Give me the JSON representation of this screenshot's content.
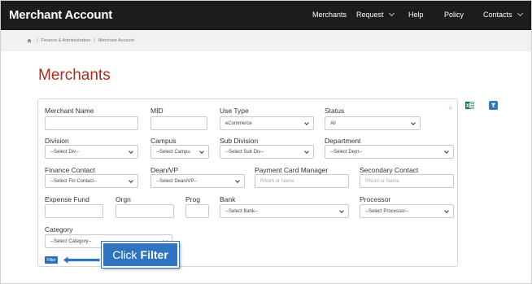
{
  "navbar": {
    "brand": "Merchant Account",
    "items": [
      {
        "label": "Merchants",
        "dropdown": false
      },
      {
        "label": "Request",
        "dropdown": true
      },
      {
        "label": "Help",
        "dropdown": false
      },
      {
        "label": "Policy",
        "dropdown": false
      },
      {
        "label": "Contacts",
        "dropdown": true
      }
    ]
  },
  "breadcrumb": {
    "sep1": "/",
    "item1": "Finance & Administration",
    "sep2": "/",
    "item2": "Merchant Account"
  },
  "page": {
    "title": "Merchants"
  },
  "form": {
    "merchant_name": {
      "label": "Merchant Name",
      "value": ""
    },
    "mid": {
      "label": "MID",
      "value": ""
    },
    "use_type": {
      "label": "Use Type",
      "value": "eCommerce"
    },
    "status": {
      "label": "Status",
      "value": "All"
    },
    "division": {
      "label": "Division",
      "value": "--Select Div--"
    },
    "campus": {
      "label": "Campus",
      "value": "--Select Campu"
    },
    "sub_division": {
      "label": "Sub Division",
      "value": "--Select Sub Div--"
    },
    "department": {
      "label": "Department",
      "value": "--Select Dept--"
    },
    "finance_contact": {
      "label": "Finance Contact",
      "value": "--Select Fin Contact--"
    },
    "dean_vp": {
      "label": "Dean/VP",
      "value": "--Select Dean/VP--"
    },
    "payment_card_manager": {
      "label": "Payment Card Manager",
      "placeholder": "RNum or Name"
    },
    "secondary_contact": {
      "label": "Secondary Contact",
      "placeholder": "RNum or Name"
    },
    "expense_fund": {
      "label": "Expense Fund",
      "value": ""
    },
    "orgn": {
      "label": "Orgn",
      "value": ""
    },
    "prog": {
      "label": "Prog",
      "value": ""
    },
    "bank": {
      "label": "Bank",
      "value": "--Select Bank--"
    },
    "processor": {
      "label": "Processor",
      "value": "--Select Processor--"
    },
    "category": {
      "label": "Category",
      "value": "--Select Category--"
    },
    "close": "×",
    "filter_button": "Filter"
  },
  "callout": {
    "prefix": "Click",
    "emphasis": "Filter"
  },
  "colors": {
    "navbar_bg": "#1c1c1c",
    "title_red": "#b22b1f",
    "accent_blue": "#2c6fbf",
    "excel_green": "#1f7a45"
  }
}
